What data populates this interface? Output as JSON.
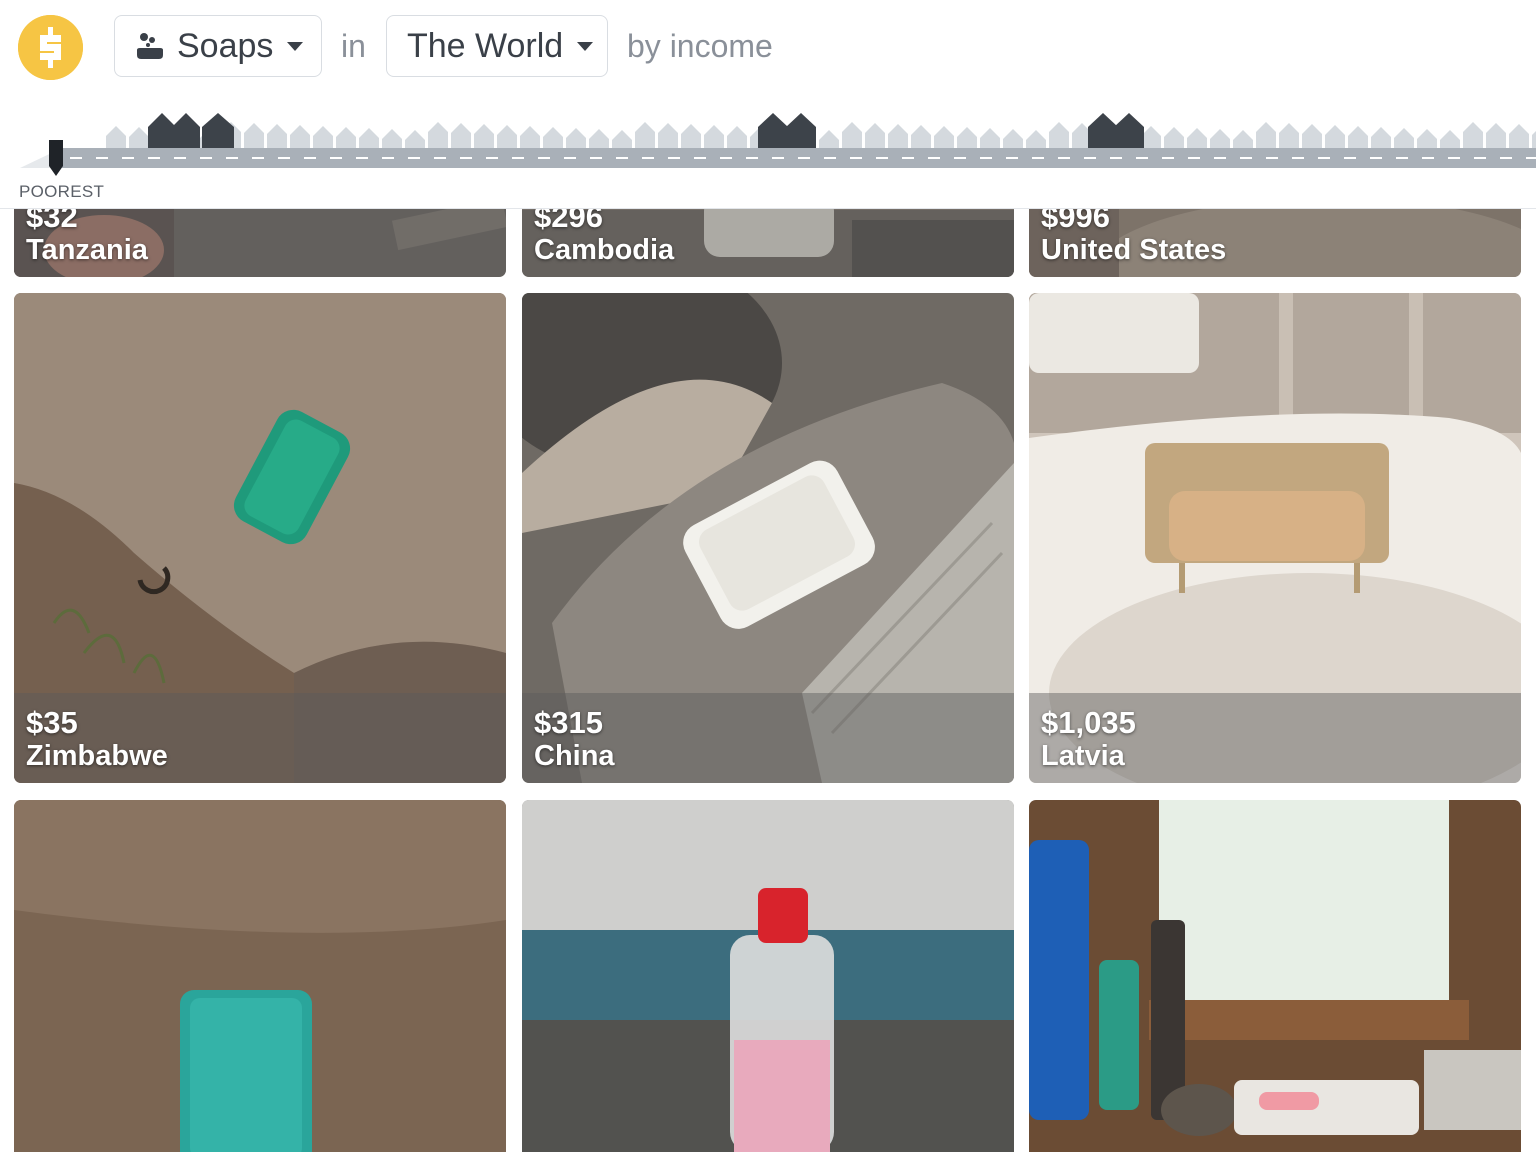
{
  "header": {
    "topic_label": "Soaps",
    "connector_in": "in",
    "region_label": "The World",
    "suffix": "by income",
    "scale_label": "POOREST"
  },
  "icons": {
    "logo": "dollar-street-logo",
    "topic": "soap-bubbles-icon",
    "dropdown": "caret-down-icon",
    "marker": "income-marker"
  },
  "colors": {
    "brand_yellow": "#f6c544",
    "road": "#a9b0b8",
    "house": "#d4d9de",
    "house_dark": "#3d434a"
  },
  "tiles": [
    {
      "income": "$32",
      "country": "Tanzania"
    },
    {
      "income": "$296",
      "country": "Cambodia"
    },
    {
      "income": "$996",
      "country": "United States"
    },
    {
      "income": "$35",
      "country": "Zimbabwe"
    },
    {
      "income": "$315",
      "country": "China"
    },
    {
      "income": "$1,035",
      "country": "Latvia"
    }
  ]
}
